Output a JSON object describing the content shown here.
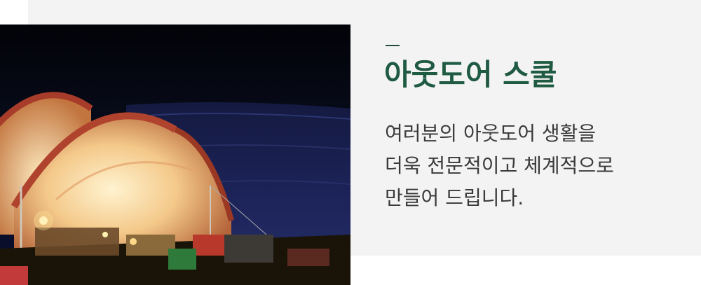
{
  "section": {
    "accent": "—",
    "title": "아웃도어 스쿨",
    "description_lines": [
      "여러분의 아웃도어 생활을",
      "더욱 전문적이고 체계적으로",
      "만들어 드립니다."
    ]
  },
  "photo": {
    "subject": "camping-tents-at-night"
  },
  "colors": {
    "title": "#1f5a43",
    "accent_dash": "#1f4f3a",
    "text": "#3a3a3a",
    "panel_bg": "#f3f3f3"
  }
}
